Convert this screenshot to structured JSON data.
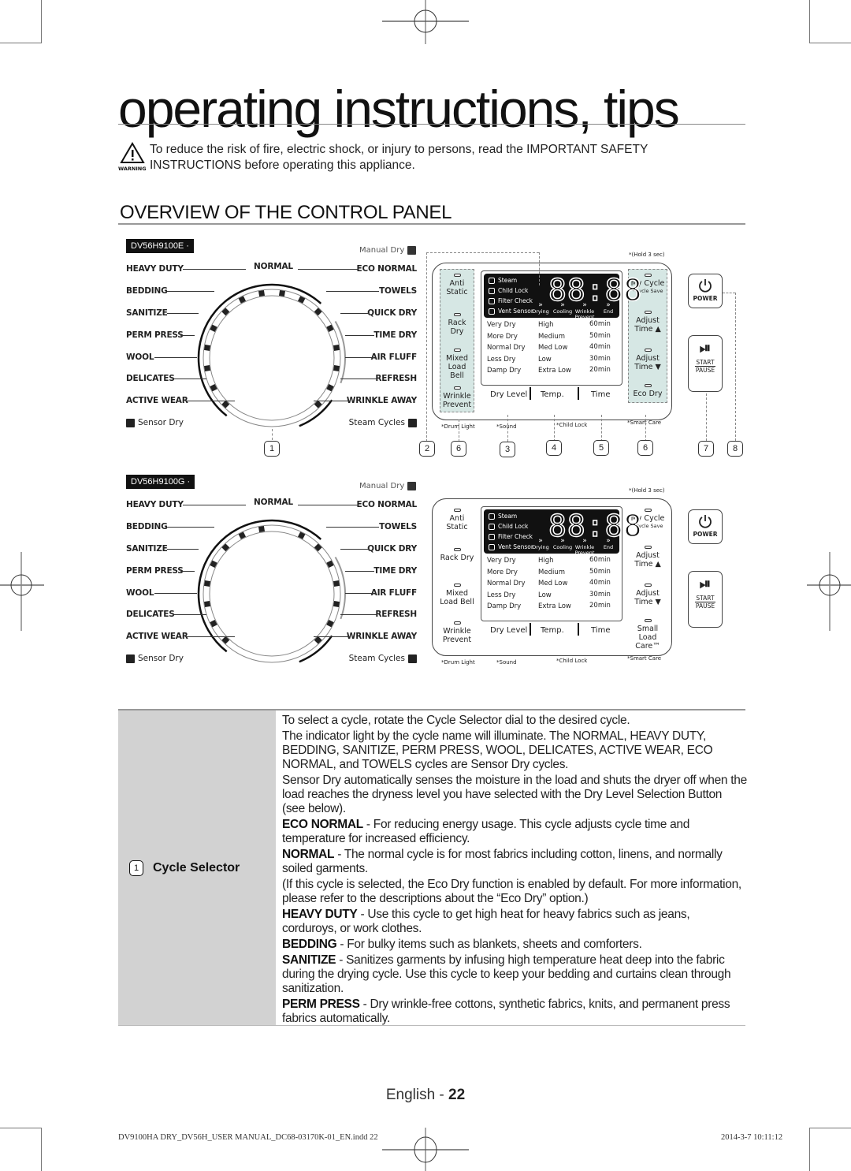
{
  "page": {
    "title": "operating instructions, tips",
    "warning": {
      "icon": "warning-triangle-icon",
      "icon_label": "WARNING",
      "text": "To reduce the risk of fire, electric shock, or injury to persons, read the IMPORTANT SAFETY INSTRUCTIONS before operating this appliance."
    },
    "section_heading": "OVERVIEW OF THE CONTROL PANEL"
  },
  "panels": [
    {
      "model": "DV56H9100E",
      "manual_dry": "Manual Dry",
      "dial": {
        "top_label": "NORMAL",
        "left_labels": [
          "HEAVY DUTY",
          "BEDDING",
          "SANITIZE",
          "PERM PRESS",
          "WOOL",
          "DELICATES",
          "ACTIVE WEAR"
        ],
        "right_labels": [
          "ECO NORMAL",
          "TOWELS",
          "QUICK DRY",
          "TIME DRY",
          "AIR FLUFF",
          "REFRESH",
          "WRINKLE AWAY"
        ],
        "sensor_dry": "Sensor Dry",
        "steam_cycles": "Steam Cycles"
      },
      "hold_note": "*(Hold 3 sec)",
      "left_buttons": [
        "Anti Static",
        "Rack Dry",
        "Mixed Load Bell",
        "Wrinkle Prevent"
      ],
      "right_buttons": [
        {
          "label": "My Cycle",
          "sub": "*Cycle Save"
        },
        {
          "label": "Adjust Time ▲",
          "sub": ""
        },
        {
          "label": "Adjust Time ▼",
          "sub": ""
        },
        {
          "label": "Eco Dry",
          "sub": ""
        }
      ],
      "lcd": {
        "indicators": [
          "Steam",
          "Child Lock",
          "Filter Check",
          "Vent Sensor"
        ],
        "digits": "88:88",
        "stages": [
          "Drying",
          "Cooling",
          "Wrinkle Prevent",
          "End"
        ]
      },
      "dry_levels": [
        "Very Dry",
        "More Dry",
        "Normal Dry",
        "Less Dry",
        "Damp Dry"
      ],
      "temps": [
        "High",
        "Medium",
        "Med Low",
        "Low",
        "Extra Low"
      ],
      "times": [
        "60min",
        "50min",
        "40min",
        "30min",
        "20min"
      ],
      "option_buttons": [
        "Dry Level",
        "Temp.",
        "Time"
      ],
      "sub_notes": {
        "drum_light": "*Drum Light",
        "sound": "*Sound",
        "child_lock": "*Child Lock",
        "smart_care": "*Smart Care"
      },
      "power_label": "POWER",
      "start_label": "START",
      "pause_label": "PAUSE",
      "callouts": [
        "1",
        "2",
        "6",
        "3",
        "4",
        "5",
        "6",
        "7",
        "8"
      ]
    },
    {
      "model": "DV56H9100G",
      "manual_dry": "Manual Dry",
      "dial": {
        "top_label": "NORMAL",
        "left_labels": [
          "HEAVY DUTY",
          "BEDDING",
          "SANITIZE",
          "PERM PRESS",
          "WOOL",
          "DELICATES",
          "ACTIVE WEAR"
        ],
        "right_labels": [
          "ECO NORMAL",
          "TOWELS",
          "QUICK DRY",
          "TIME DRY",
          "AIR FLUFF",
          "REFRESH",
          "WRINKLE AWAY"
        ],
        "sensor_dry": "Sensor Dry",
        "steam_cycles": "Steam Cycles"
      },
      "hold_note": "*(Hold 3 sec)",
      "left_buttons": [
        "Anti Static",
        "Rack Dry",
        "Mixed Load Bell",
        "Wrinkle Prevent"
      ],
      "right_buttons": [
        {
          "label": "My Cycle",
          "sub": "*Cycle Save"
        },
        {
          "label": "Adjust Time ▲",
          "sub": ""
        },
        {
          "label": "Adjust Time ▼",
          "sub": ""
        },
        {
          "label": "Small Load Care™",
          "sub": ""
        }
      ],
      "lcd": {
        "indicators": [
          "Steam",
          "Child Lock",
          "Filter Check",
          "Vent Sensor"
        ],
        "digits": "88:88",
        "stages": [
          "Drying",
          "Cooling",
          "Wrinkle Prevent",
          "End"
        ]
      },
      "dry_levels": [
        "Very Dry",
        "More Dry",
        "Normal Dry",
        "Less Dry",
        "Damp Dry"
      ],
      "temps": [
        "High",
        "Medium",
        "Med Low",
        "Low",
        "Extra Low"
      ],
      "times": [
        "60min",
        "50min",
        "40min",
        "30min",
        "20min"
      ],
      "option_buttons": [
        "Dry Level",
        "Temp.",
        "Time"
      ],
      "sub_notes": {
        "drum_light": "*Drum Light",
        "sound": "*Sound",
        "child_lock": "*Child Lock",
        "smart_care": "*Smart Care"
      },
      "power_label": "POWER",
      "start_label": "START",
      "pause_label": "PAUSE"
    }
  ],
  "description": {
    "number": "1",
    "label": "Cycle Selector",
    "paragraphs": [
      {
        "bold": "",
        "text": "To select a cycle, rotate the Cycle Selector dial to the desired cycle."
      },
      {
        "bold": "",
        "text": "The indicator light by the cycle name will illuminate. The NORMAL, HEAVY DUTY, BEDDING, SANITIZE, PERM PRESS, WOOL, DELICATES, ACTIVE WEAR, ECO NORMAL, and TOWELS cycles are Sensor Dry cycles."
      },
      {
        "bold": "",
        "text": "Sensor Dry automatically senses the moisture in the load and shuts the dryer off when the load reaches the dryness level you have selected with the Dry Level Selection Button (see below)."
      },
      {
        "bold": "ECO NORMAL",
        "text": " - For reducing energy usage. This cycle adjusts cycle time and temperature for increased efficiency."
      },
      {
        "bold": "NORMAL",
        "text": " - The normal cycle is for most fabrics including cotton, linens, and normally soiled garments."
      },
      {
        "bold": "",
        "text": "(If this cycle is selected, the Eco Dry function is enabled by default. For more information, please refer to the descriptions about the “Eco Dry” option.)"
      },
      {
        "bold": "HEAVY DUTY",
        "text": " - Use this cycle to get high heat for heavy fabrics such as jeans, corduroys, or work clothes."
      },
      {
        "bold": "BEDDING",
        "text": " - For bulky items such as blankets, sheets and comforters."
      },
      {
        "bold": "SANITIZE",
        "text": " - Sanitizes garments by infusing high temperature heat deep into the fabric during the drying cycle. Use this cycle to keep your bedding and curtains clean through sanitization."
      },
      {
        "bold": "PERM PRESS",
        "text": " - Dry wrinkle-free cottons, synthetic fabrics, knits, and permanent press fabrics automatically."
      }
    ]
  },
  "footer": {
    "language": "English - ",
    "page_number": "22",
    "file_info": "DV9100HA DRY_DV56H_USER MANUAL_DC68-03170K-01_EN.indd   22",
    "timestamp": "2014-3-7   10:11:12"
  },
  "colors": {
    "panel_teal": "#d6e7e4",
    "lcd_black": "#111111",
    "table_gray": "#d2d2d2"
  }
}
